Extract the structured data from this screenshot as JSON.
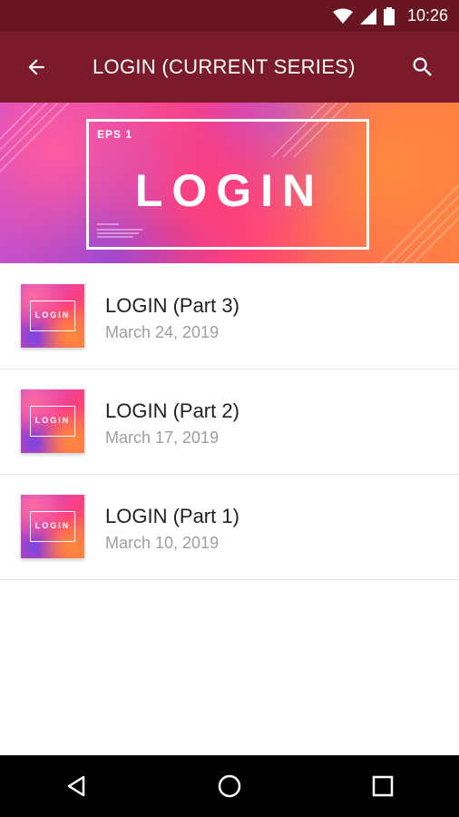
{
  "status_bar": {
    "time": "10:26"
  },
  "app_bar": {
    "title": "LOGIN (CURRENT SERIES)",
    "back_icon": "arrow-back-icon",
    "search_icon": "search-icon"
  },
  "hero": {
    "episode": "EPS 1",
    "title": "LOGIN"
  },
  "episodes": [
    {
      "title": "LOGIN (Part 3)",
      "date": "March 24, 2019",
      "thumb_label": "LOGIN"
    },
    {
      "title": "LOGIN (Part 2)",
      "date": "March 17, 2019",
      "thumb_label": "LOGIN"
    },
    {
      "title": "LOGIN (Part 1)",
      "date": "March 10, 2019",
      "thumb_label": "LOGIN"
    }
  ],
  "colors": {
    "status_bar": "#6a1522",
    "app_bar": "#7a1a2a",
    "title_text": "#212121",
    "date_text": "#9e9e9e"
  }
}
